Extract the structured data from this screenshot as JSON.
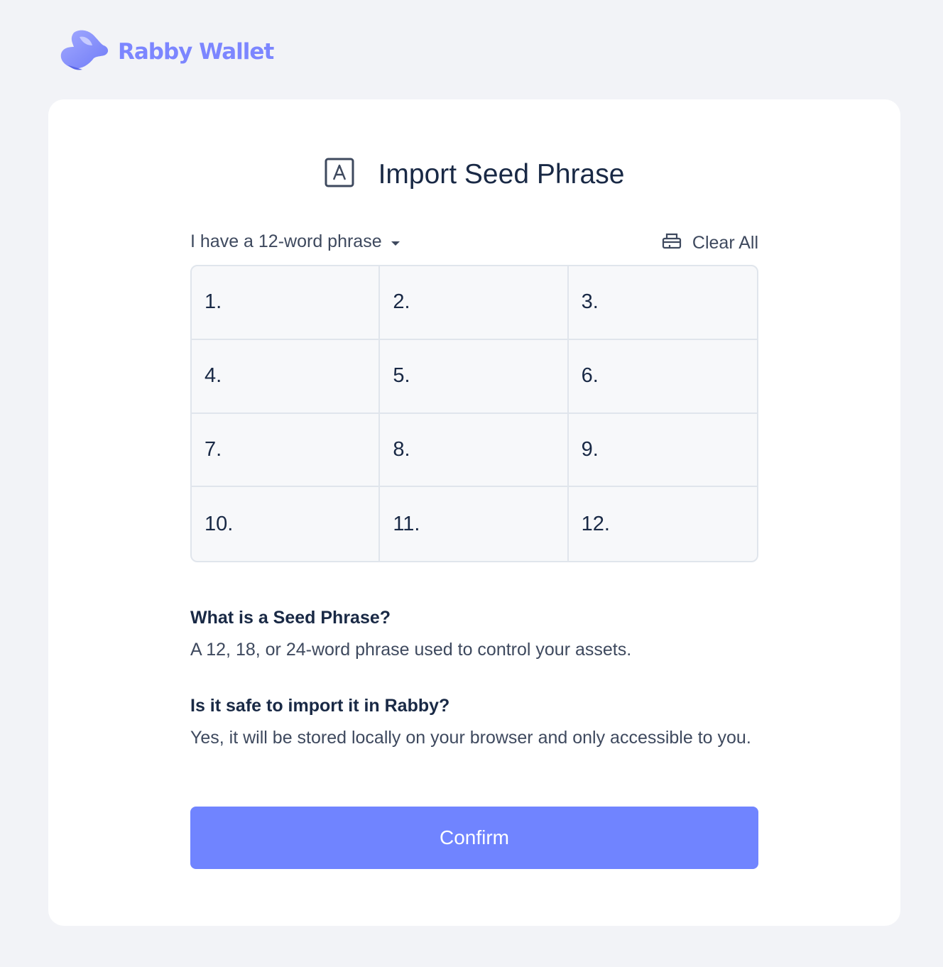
{
  "brand": {
    "name": "Rabby Wallet",
    "logo_icon": "rabbit-logo-icon",
    "color": "#7c86ff"
  },
  "page": {
    "title": "Import Seed Phrase",
    "title_icon": "letter-a-box-icon"
  },
  "controls": {
    "phrase_type": "I have a 12-word phrase",
    "phrase_type_icon": "caret-down-icon",
    "clear_all": "Clear All",
    "clear_all_icon": "eraser-icon"
  },
  "seed_inputs": [
    {
      "index": "1.",
      "value": ""
    },
    {
      "index": "2.",
      "value": ""
    },
    {
      "index": "3.",
      "value": ""
    },
    {
      "index": "4.",
      "value": ""
    },
    {
      "index": "5.",
      "value": ""
    },
    {
      "index": "6.",
      "value": ""
    },
    {
      "index": "7.",
      "value": ""
    },
    {
      "index": "8.",
      "value": ""
    },
    {
      "index": "9.",
      "value": ""
    },
    {
      "index": "10.",
      "value": ""
    },
    {
      "index": "11.",
      "value": ""
    },
    {
      "index": "12.",
      "value": ""
    }
  ],
  "faq": [
    {
      "question": "What is a Seed Phrase?",
      "answer": "A 12, 18, or 24-word phrase used to control your assets."
    },
    {
      "question": "Is it safe to import it in Rabby?",
      "answer": "Yes, it will be stored locally on your browser and only accessible to you."
    }
  ],
  "confirm_label": "Confirm",
  "colors": {
    "accent": "#7084ff",
    "background": "#f2f3f7",
    "text": "#192945"
  }
}
